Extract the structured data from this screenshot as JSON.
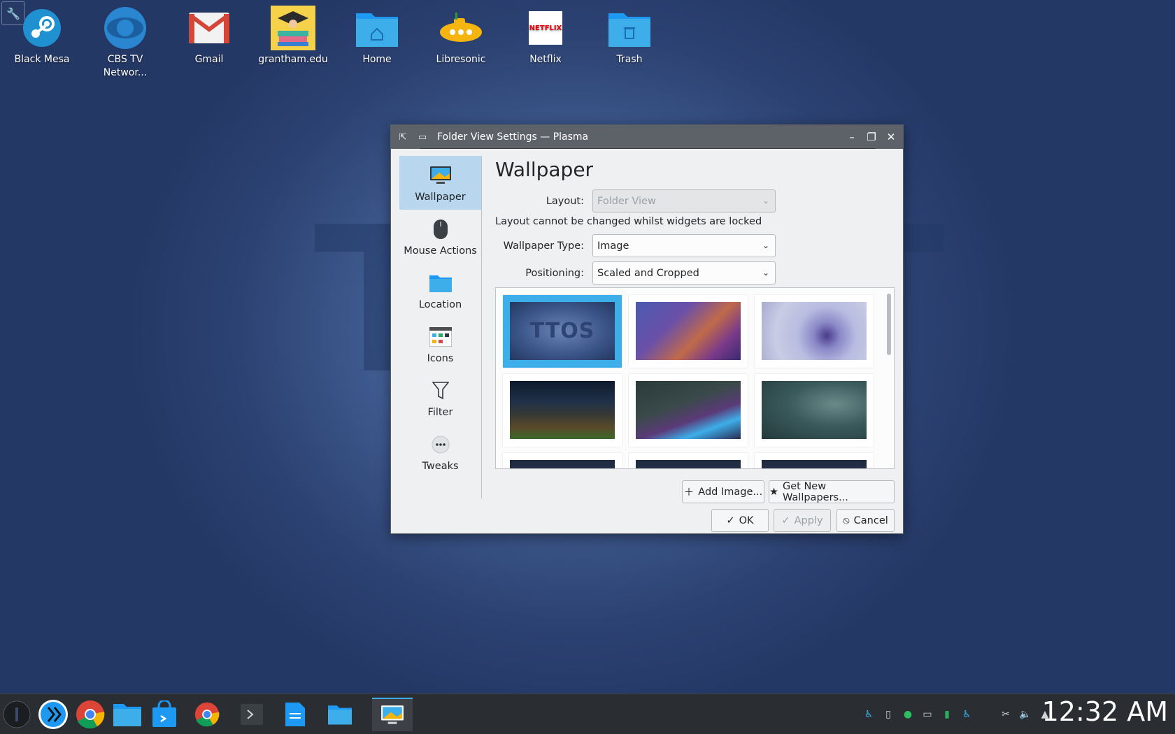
{
  "desktop": {
    "icons": [
      {
        "label": "Black Mesa",
        "icon": "steam-icon"
      },
      {
        "label": "CBS TV Networ...",
        "icon": "cbs-eye-icon"
      },
      {
        "label": "Gmail",
        "icon": "gmail-icon"
      },
      {
        "label": "grantham.edu",
        "icon": "graduation-icon"
      },
      {
        "label": "Home",
        "icon": "home-folder-icon"
      },
      {
        "label": "Libresonic",
        "icon": "submarine-icon"
      },
      {
        "label": "Netflix",
        "icon": "netflix-icon"
      },
      {
        "label": "Trash",
        "icon": "trash-folder-icon"
      }
    ],
    "netflix_text": "NETFLIX",
    "tool_icon": "wrench-icon"
  },
  "dialog": {
    "title": "Folder View Settings — Plasma",
    "sidebar": [
      {
        "label": "Wallpaper",
        "icon": "monitor-icon",
        "active": true
      },
      {
        "label": "Mouse Actions",
        "icon": "mouse-icon"
      },
      {
        "label": "Location",
        "icon": "folder-icon"
      },
      {
        "label": "Icons",
        "icon": "icons-grid-icon"
      },
      {
        "label": "Filter",
        "icon": "filter-icon"
      },
      {
        "label": "Tweaks",
        "icon": "more-icon"
      }
    ],
    "page_title": "Wallpaper",
    "layout": {
      "label": "Layout:",
      "value": "Folder View"
    },
    "lock_note": "Layout cannot be changed whilst widgets are locked",
    "wallpaper_type": {
      "label": "Wallpaper Type:",
      "value": "Image"
    },
    "positioning": {
      "label": "Positioning:",
      "value": "Scaled and Cropped"
    },
    "wallpapers": [
      {
        "name": "ttos",
        "text": "TTOS",
        "selected": true
      },
      {
        "name": "geometric-purple"
      },
      {
        "name": "dandelion"
      },
      {
        "name": "coast-night"
      },
      {
        "name": "purple-teal-shapes"
      },
      {
        "name": "swirl-teal"
      }
    ],
    "buttons": {
      "add_image": "Add Image...",
      "get_new": "Get New Wallpapers...",
      "ok": "OK",
      "apply": "Apply",
      "cancel": "Cancel"
    }
  },
  "taskbar": {
    "clock": "12:32 AM"
  },
  "colors": {
    "accent": "#3daee9",
    "selection": "#b8d7ee",
    "titlebar": "#5d6268"
  }
}
